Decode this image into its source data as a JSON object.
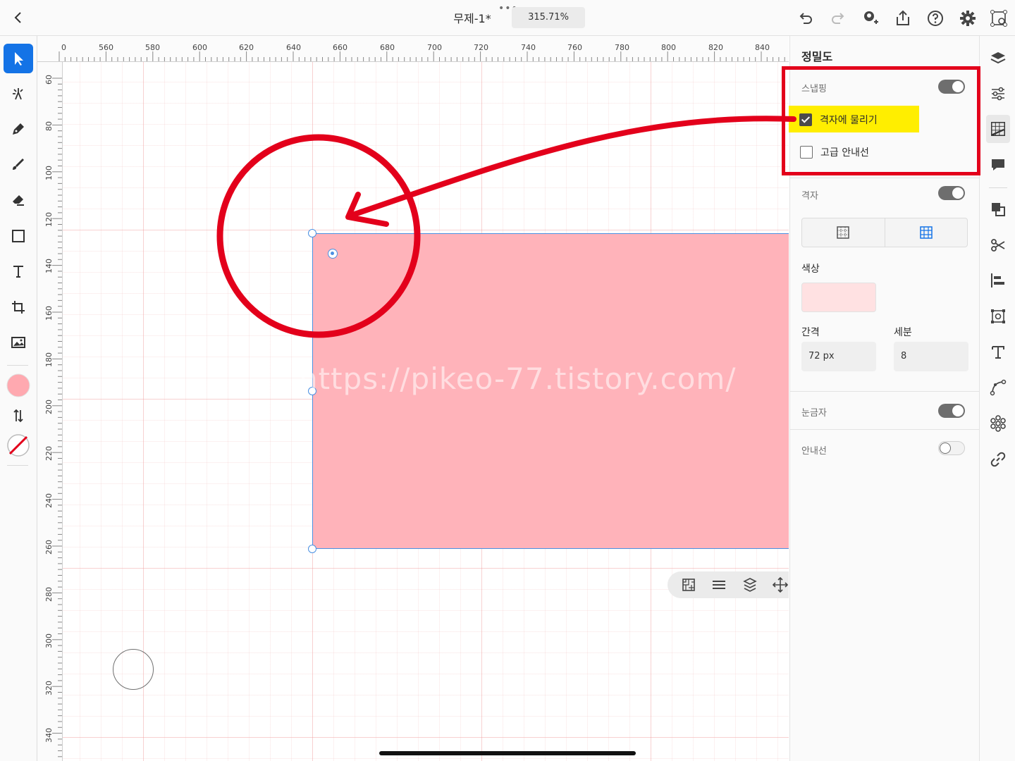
{
  "header": {
    "document_title": "무제-1*",
    "more_dots": "•••",
    "zoom": "315.71%"
  },
  "ruler": {
    "top_ticks": [
      "0",
      "560",
      "580",
      "600",
      "620",
      "640",
      "660",
      "680",
      "700",
      "720",
      "740",
      "760",
      "780",
      "800",
      "820",
      "840"
    ],
    "left_ticks": [
      "60",
      "80",
      "100",
      "120",
      "140",
      "160",
      "180",
      "200",
      "220",
      "240",
      "260",
      "280",
      "300",
      "320",
      "340"
    ]
  },
  "canvas": {
    "watermark": "https://pikeo-77.tistory.com/",
    "shape_fill": "#ffb3ba"
  },
  "panel": {
    "title": "정밀도",
    "snapping": {
      "label": "스냅핑",
      "enabled": true
    },
    "snap_to_grid": {
      "label": "격자에 물리기",
      "checked": true
    },
    "advanced_guides": {
      "label": "고급 안내선",
      "checked": false
    },
    "grid": {
      "label": "격자",
      "enabled": true
    },
    "color": {
      "label": "색상",
      "value": "#ffe1e2"
    },
    "spacing": {
      "label": "간격",
      "value": "72 px"
    },
    "subdivisions": {
      "label": "세분",
      "value": "8"
    },
    "rulers": {
      "label": "눈금자",
      "enabled": true
    },
    "guides": {
      "label": "안내선",
      "enabled": false
    }
  },
  "colors": {
    "accent": "#1473e6",
    "annotation_red": "#e3001b",
    "highlight_yellow": "#ffee00",
    "fill_swatch": "#ffa9b0"
  }
}
